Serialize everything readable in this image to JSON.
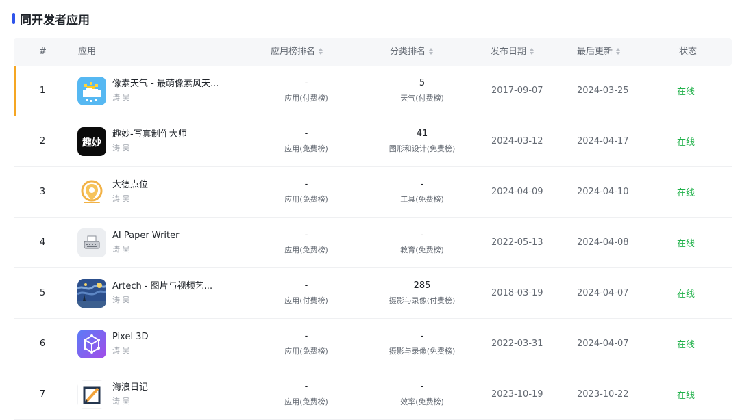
{
  "section": {
    "title": "同开发者应用"
  },
  "table": {
    "headers": {
      "index": "#",
      "app": "应用",
      "app_rank": "应用榜排名",
      "category_rank": "分类排名",
      "publish_date": "发布日期",
      "last_update": "最后更新",
      "status": "状态"
    },
    "rows": [
      {
        "index": "1",
        "name": "像素天气 - 最萌像素风天...",
        "developer": "涛 吴",
        "icon": "pixel-weather-icon",
        "app_rank": "-",
        "app_rank_list": "应用(付费榜)",
        "category_rank": "5",
        "category_list": "天气(付费榜)",
        "publish_date": "2017-09-07",
        "last_update": "2024-03-25",
        "status": "在线"
      },
      {
        "index": "2",
        "name": "趣妙-写真制作大师",
        "developer": "涛 吴",
        "icon": "qumiao-icon",
        "icon_text": "趣妙",
        "app_rank": "-",
        "app_rank_list": "应用(免费榜)",
        "category_rank": "41",
        "category_list": "图形和设计(免费榜)",
        "publish_date": "2024-03-12",
        "last_update": "2024-04-17",
        "status": "在线"
      },
      {
        "index": "3",
        "name": "大德点位",
        "developer": "涛 吴",
        "icon": "location-pin-icon",
        "app_rank": "-",
        "app_rank_list": "应用(免费榜)",
        "category_rank": "-",
        "category_list": "工具(免费榜)",
        "publish_date": "2024-04-09",
        "last_update": "2024-04-10",
        "status": "在线"
      },
      {
        "index": "4",
        "name": "AI Paper Writer",
        "developer": "涛 吴",
        "icon": "typewriter-icon",
        "app_rank": "-",
        "app_rank_list": "应用(免费榜)",
        "category_rank": "-",
        "category_list": "教育(免费榜)",
        "publish_date": "2022-05-13",
        "last_update": "2024-04-08",
        "status": "在线"
      },
      {
        "index": "5",
        "name": "Artech - 图片与视频艺...",
        "developer": "涛 吴",
        "icon": "starry-night-icon",
        "app_rank": "-",
        "app_rank_list": "应用(付费榜)",
        "category_rank": "285",
        "category_list": "摄影与录像(付费榜)",
        "publish_date": "2018-03-19",
        "last_update": "2024-04-07",
        "status": "在线"
      },
      {
        "index": "6",
        "name": "Pixel 3D",
        "developer": "涛 吴",
        "icon": "cube-icon",
        "app_rank": "-",
        "app_rank_list": "应用(免费榜)",
        "category_rank": "-",
        "category_list": "摄影与录像(免费榜)",
        "publish_date": "2022-03-31",
        "last_update": "2024-04-07",
        "status": "在线"
      },
      {
        "index": "7",
        "name": "海浪日记",
        "developer": "涛 吴",
        "icon": "pencil-note-icon",
        "app_rank": "-",
        "app_rank_list": "应用(免费榜)",
        "category_rank": "-",
        "category_list": "效率(免费榜)",
        "publish_date": "2023-10-19",
        "last_update": "2023-10-22",
        "status": "在线"
      }
    ]
  },
  "colors": {
    "accent": "#2f54eb",
    "active_row_marker": "#f5a623",
    "status_online": "#20b14a"
  }
}
